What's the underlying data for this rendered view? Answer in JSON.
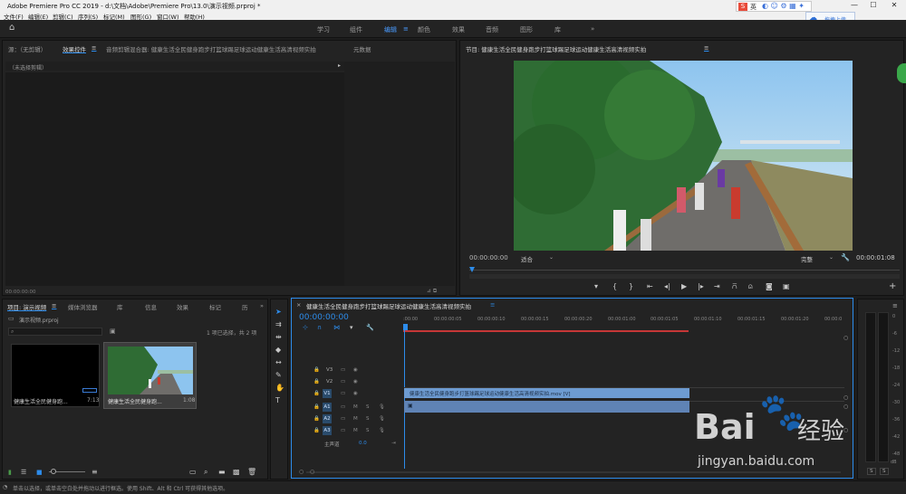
{
  "app": {
    "title": "Adobe Premiere Pro CC 2019 - d:\\文档\\Adobe\\Premiere Pro\\13.0\\演示视频.prproj *",
    "window_controls": [
      "—",
      "☐",
      "✕"
    ]
  },
  "overlay": {
    "ime_badge": "S",
    "ime_lang": "英",
    "cloud_upload": "拖拽上传"
  },
  "menu": [
    "文件(F)",
    "编辑(E)",
    "剪辑(C)",
    "序列(S)",
    "标记(M)",
    "图形(G)",
    "窗口(W)",
    "帮助(H)"
  ],
  "workspaces": {
    "tabs": [
      "学习",
      "组件",
      "编辑",
      "颜色",
      "效果",
      "音频",
      "图形",
      "库"
    ],
    "active": "编辑",
    "more": "»"
  },
  "source_panel": {
    "tabs": [
      "源：（无剪辑）",
      "效果控件",
      "音频剪辑混合器: 健康生活全民健身跑步打篮球踢足球运动健康生活高清视频实拍",
      "元数据"
    ],
    "subheader": "（未选择剪辑）",
    "timecode": "00:00:00:00"
  },
  "program_monitor": {
    "title": "节目: 健康生活全民健身跑步打篮球踢足球运动健康生活高清视频实拍",
    "timecode": "00:00:00:00",
    "fit": "适合",
    "quality": "完整",
    "duration": "00:00:01:08"
  },
  "project_panel": {
    "tabs": [
      "项目: 演示视频",
      "媒体浏览器",
      "库",
      "信息",
      "效果",
      "标记",
      "历"
    ],
    "file": "演示视频.prproj",
    "selection": "1 项已选择，共 2 项",
    "items": [
      {
        "name": "健康生活全民健身跑...",
        "duration": "7:13"
      },
      {
        "name": "健康生活全民健身跑...",
        "duration": "1:08"
      }
    ]
  },
  "timeline": {
    "title": "健康生活全民健身跑步打篮球踢足球运动健康生活高清视频实拍",
    "timecode": "00:00:00:00",
    "ruler": [
      ":00:00",
      "00:00:00:05",
      "00:00:00:10",
      "00:00:00:15",
      "00:00:00:20",
      "00:00:01:00",
      "00:00:01:05",
      "00:00:01:10",
      "00:00:01:15",
      "00:00:01:20",
      "00:00:0"
    ],
    "tracks": [
      {
        "name": "V3"
      },
      {
        "name": "V2"
      },
      {
        "name": "V1"
      },
      {
        "name": "A1"
      },
      {
        "name": "A2"
      },
      {
        "name": "A3"
      }
    ],
    "track_toggles": [
      "M",
      "S"
    ],
    "master": "主声道",
    "master_value": "0.0",
    "clip_label": "健康生活全民健身跑步打篮球踢足球运动健康生活高清视频实拍.mov [V]"
  },
  "meter": {
    "db": "dB",
    "solo": [
      "S",
      "S"
    ],
    "levels": [
      "0",
      "-6",
      "-12",
      "-18",
      "-24",
      "-30",
      "-36",
      "-42",
      "-48"
    ]
  },
  "status": "单击以选择，或单击空白处并拖动以进行框选。使用 Shift、Alt 和 Ctrl 可获得其他选项。",
  "watermark": {
    "brand": "Bai",
    "brand2": "经验",
    "url": "jingyan.baidu.com"
  },
  "colors": {
    "accent": "#2d8ceb",
    "panel": "#232323",
    "clip_video": "#6d9bd1",
    "clip_audio": "#5f83b5",
    "playhead": "#2d8ceb"
  }
}
